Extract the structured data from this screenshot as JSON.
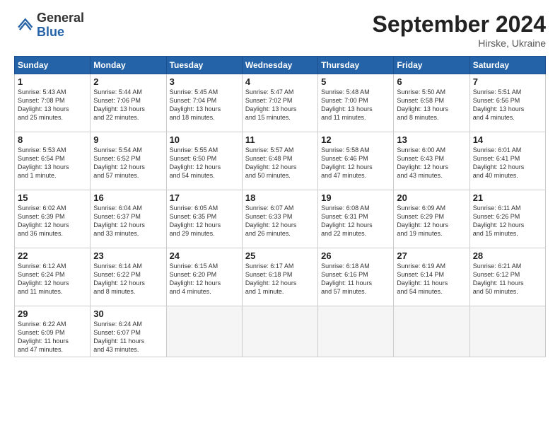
{
  "logo": {
    "general": "General",
    "blue": "Blue"
  },
  "title": "September 2024",
  "location": "Hirske, Ukraine",
  "headers": [
    "Sunday",
    "Monday",
    "Tuesday",
    "Wednesday",
    "Thursday",
    "Friday",
    "Saturday"
  ],
  "rows": [
    [
      {
        "day": "1",
        "info": "Sunrise: 5:43 AM\nSunset: 7:08 PM\nDaylight: 13 hours\nand 25 minutes."
      },
      {
        "day": "2",
        "info": "Sunrise: 5:44 AM\nSunset: 7:06 PM\nDaylight: 13 hours\nand 22 minutes."
      },
      {
        "day": "3",
        "info": "Sunrise: 5:45 AM\nSunset: 7:04 PM\nDaylight: 13 hours\nand 18 minutes."
      },
      {
        "day": "4",
        "info": "Sunrise: 5:47 AM\nSunset: 7:02 PM\nDaylight: 13 hours\nand 15 minutes."
      },
      {
        "day": "5",
        "info": "Sunrise: 5:48 AM\nSunset: 7:00 PM\nDaylight: 13 hours\nand 11 minutes."
      },
      {
        "day": "6",
        "info": "Sunrise: 5:50 AM\nSunset: 6:58 PM\nDaylight: 13 hours\nand 8 minutes."
      },
      {
        "day": "7",
        "info": "Sunrise: 5:51 AM\nSunset: 6:56 PM\nDaylight: 13 hours\nand 4 minutes."
      }
    ],
    [
      {
        "day": "8",
        "info": "Sunrise: 5:53 AM\nSunset: 6:54 PM\nDaylight: 13 hours\nand 1 minute."
      },
      {
        "day": "9",
        "info": "Sunrise: 5:54 AM\nSunset: 6:52 PM\nDaylight: 12 hours\nand 57 minutes."
      },
      {
        "day": "10",
        "info": "Sunrise: 5:55 AM\nSunset: 6:50 PM\nDaylight: 12 hours\nand 54 minutes."
      },
      {
        "day": "11",
        "info": "Sunrise: 5:57 AM\nSunset: 6:48 PM\nDaylight: 12 hours\nand 50 minutes."
      },
      {
        "day": "12",
        "info": "Sunrise: 5:58 AM\nSunset: 6:46 PM\nDaylight: 12 hours\nand 47 minutes."
      },
      {
        "day": "13",
        "info": "Sunrise: 6:00 AM\nSunset: 6:43 PM\nDaylight: 12 hours\nand 43 minutes."
      },
      {
        "day": "14",
        "info": "Sunrise: 6:01 AM\nSunset: 6:41 PM\nDaylight: 12 hours\nand 40 minutes."
      }
    ],
    [
      {
        "day": "15",
        "info": "Sunrise: 6:02 AM\nSunset: 6:39 PM\nDaylight: 12 hours\nand 36 minutes."
      },
      {
        "day": "16",
        "info": "Sunrise: 6:04 AM\nSunset: 6:37 PM\nDaylight: 12 hours\nand 33 minutes."
      },
      {
        "day": "17",
        "info": "Sunrise: 6:05 AM\nSunset: 6:35 PM\nDaylight: 12 hours\nand 29 minutes."
      },
      {
        "day": "18",
        "info": "Sunrise: 6:07 AM\nSunset: 6:33 PM\nDaylight: 12 hours\nand 26 minutes."
      },
      {
        "day": "19",
        "info": "Sunrise: 6:08 AM\nSunset: 6:31 PM\nDaylight: 12 hours\nand 22 minutes."
      },
      {
        "day": "20",
        "info": "Sunrise: 6:09 AM\nSunset: 6:29 PM\nDaylight: 12 hours\nand 19 minutes."
      },
      {
        "day": "21",
        "info": "Sunrise: 6:11 AM\nSunset: 6:26 PM\nDaylight: 12 hours\nand 15 minutes."
      }
    ],
    [
      {
        "day": "22",
        "info": "Sunrise: 6:12 AM\nSunset: 6:24 PM\nDaylight: 12 hours\nand 11 minutes."
      },
      {
        "day": "23",
        "info": "Sunrise: 6:14 AM\nSunset: 6:22 PM\nDaylight: 12 hours\nand 8 minutes."
      },
      {
        "day": "24",
        "info": "Sunrise: 6:15 AM\nSunset: 6:20 PM\nDaylight: 12 hours\nand 4 minutes."
      },
      {
        "day": "25",
        "info": "Sunrise: 6:17 AM\nSunset: 6:18 PM\nDaylight: 12 hours\nand 1 minute."
      },
      {
        "day": "26",
        "info": "Sunrise: 6:18 AM\nSunset: 6:16 PM\nDaylight: 11 hours\nand 57 minutes."
      },
      {
        "day": "27",
        "info": "Sunrise: 6:19 AM\nSunset: 6:14 PM\nDaylight: 11 hours\nand 54 minutes."
      },
      {
        "day": "28",
        "info": "Sunrise: 6:21 AM\nSunset: 6:12 PM\nDaylight: 11 hours\nand 50 minutes."
      }
    ],
    [
      {
        "day": "29",
        "info": "Sunrise: 6:22 AM\nSunset: 6:09 PM\nDaylight: 11 hours\nand 47 minutes."
      },
      {
        "day": "30",
        "info": "Sunrise: 6:24 AM\nSunset: 6:07 PM\nDaylight: 11 hours\nand 43 minutes."
      },
      {
        "day": "",
        "info": ""
      },
      {
        "day": "",
        "info": ""
      },
      {
        "day": "",
        "info": ""
      },
      {
        "day": "",
        "info": ""
      },
      {
        "day": "",
        "info": ""
      }
    ]
  ]
}
